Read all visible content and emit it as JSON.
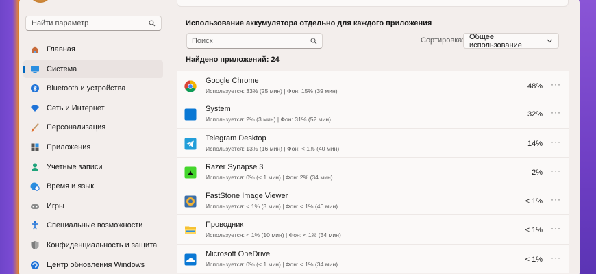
{
  "sidebar": {
    "search": {
      "placeholder": "Найти параметр",
      "icon": "search-icon"
    },
    "items": [
      {
        "label": "Главная",
        "icon": "home-icon",
        "active": false
      },
      {
        "label": "Система",
        "icon": "system-display-icon",
        "active": true
      },
      {
        "label": "Bluetooth и устройства",
        "icon": "bluetooth-icon",
        "active": false
      },
      {
        "label": "Сеть и Интернет",
        "icon": "wifi-icon",
        "active": false
      },
      {
        "label": "Персонализация",
        "icon": "brush-icon",
        "active": false
      },
      {
        "label": "Приложения",
        "icon": "apps-icon",
        "active": false
      },
      {
        "label": "Учетные записи",
        "icon": "account-icon",
        "active": false
      },
      {
        "label": "Время и язык",
        "icon": "globe-clock-icon",
        "active": false
      },
      {
        "label": "Игры",
        "icon": "gamepad-icon",
        "active": false
      },
      {
        "label": "Специальные возможности",
        "icon": "accessibility-icon",
        "active": false
      },
      {
        "label": "Конфиденциальность и защита",
        "icon": "shield-icon",
        "active": false
      },
      {
        "label": "Центр обновления Windows",
        "icon": "update-icon",
        "active": false
      }
    ]
  },
  "main": {
    "section_title": "Использование аккумулятора отдельно для каждого приложения",
    "filter_placeholder": "Поиск",
    "sort_label": "Сортировка:",
    "sort_value": "Общее использование",
    "found_text": "Найдено приложений: 24",
    "apps": [
      {
        "name": "Google Chrome",
        "detail": "Используется: 33% (25 мин) | Фон: 15% (39 мин)",
        "percent": "48%",
        "icon": "chrome-icon",
        "more": "···"
      },
      {
        "name": "System",
        "detail": "Используется: 2% (3 мин) | Фон: 31% (52 мин)",
        "percent": "32%",
        "icon": "system-app-icon",
        "more": "···"
      },
      {
        "name": "Telegram Desktop",
        "detail": "Используется: 13% (16 мин) | Фон: < 1% (40 мин)",
        "percent": "14%",
        "icon": "telegram-icon",
        "more": "···"
      },
      {
        "name": "Razer Synapse 3",
        "detail": "Используется: 0% (< 1 мин) | Фон: 2% (34 мин)",
        "percent": "2%",
        "icon": "razer-icon",
        "more": "···"
      },
      {
        "name": "FastStone Image Viewer",
        "detail": "Используется: < 1% (3 мин) | Фон: < 1% (40 мин)",
        "percent": "< 1%",
        "icon": "faststone-icon",
        "more": "···"
      },
      {
        "name": "Проводник",
        "detail": "Используется: < 1% (10 мин) | Фон: < 1% (34 мин)",
        "percent": "< 1%",
        "icon": "folder-icon",
        "more": "···"
      },
      {
        "name": "Microsoft OneDrive",
        "detail": "Используется: 0% (< 1 мин) | Фон: < 1% (34 мин)",
        "percent": "< 1%",
        "icon": "onedrive-icon",
        "more": "···"
      }
    ]
  },
  "colors": {
    "accent": "#0067c0",
    "window_bg": "#f3eeec",
    "card_bg": "#fbf9f8"
  }
}
